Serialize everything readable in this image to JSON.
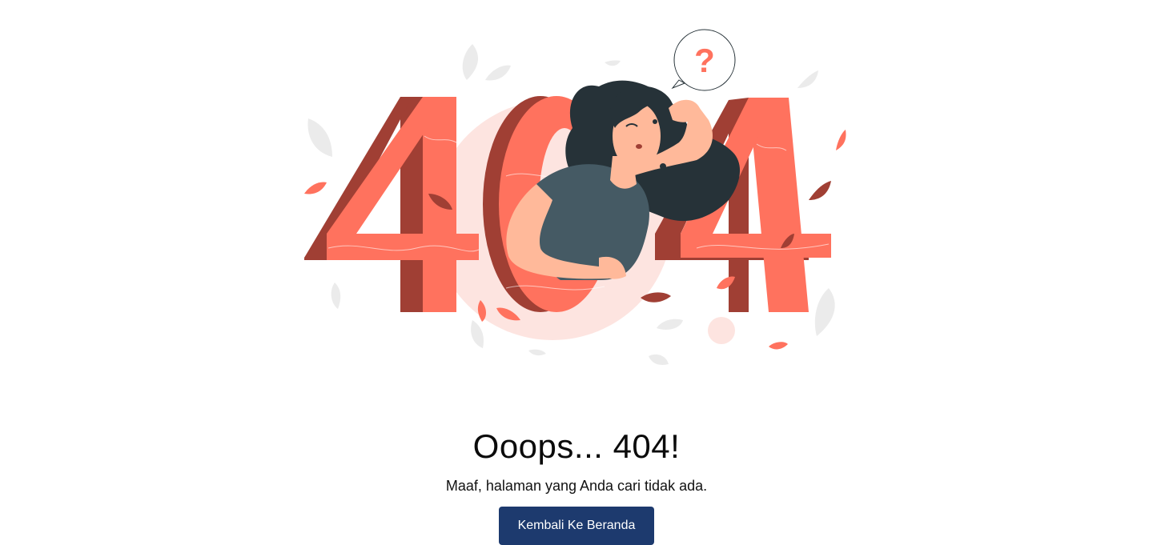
{
  "illustration": {
    "big_text": "404",
    "question_mark": "?",
    "colors": {
      "coral": "#ff725e",
      "coral_dark": "#a03f34",
      "blush": "#fde4e0",
      "shirt": "#455a64",
      "hair": "#263238",
      "skin": "#ffb99a",
      "leaf_gray": "#ebebeb"
    }
  },
  "error": {
    "title": "Ooops... 404!",
    "message": "Maaf, halaman yang Anda cari tidak ada."
  },
  "actions": {
    "home_label": "Kembali Ke Beranda",
    "home_color": "#1d3a6e"
  }
}
